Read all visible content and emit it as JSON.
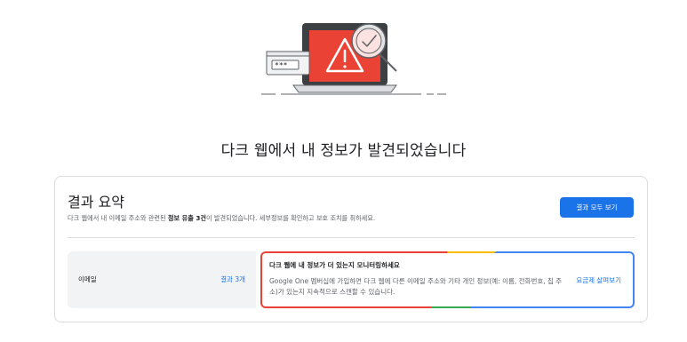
{
  "page": {
    "title": "다크 웹에서 내 정보가 발견되었습니다"
  },
  "summary": {
    "title": "결과 요약",
    "desc_prefix": "다크 웹에서 내 이메일 주소와 관련된 ",
    "desc_bold": "정보 유출 3건",
    "desc_suffix": "이 발견되었습니다. 세부정보를 확인하고 보호 조치를 취하세요.",
    "view_all_button": "결과 모두 보기"
  },
  "results": [
    {
      "label": "이메일",
      "count": "결과 3개"
    }
  ],
  "promo": {
    "title": "다크 웹에 내 정보가 더 있는지 모니터링하세요",
    "text": "Google One 멤버십에 가입하면 다크 웹에 다른 이메일 주소와 기타 개인 정보(예: 이름, 전화번호, 집 주소)가 있는지 지속적으로 스캔할 수 있습니다.",
    "link": "요금제 살펴보기"
  },
  "colors": {
    "primary": "#1a73e8",
    "alert_red": "#ea4335",
    "google_yellow": "#fbbc04",
    "google_green": "#34a853",
    "google_blue": "#4285f4"
  },
  "icons": {
    "hero": "dark-web-alert-illustration",
    "warning": "warning-triangle-icon",
    "magnifier": "magnifier-check-icon",
    "password": "password-field-icon"
  }
}
